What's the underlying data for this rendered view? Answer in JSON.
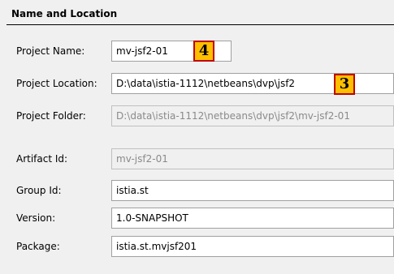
{
  "section": {
    "title": "Name and Location"
  },
  "project_name": {
    "label": "Project Name:",
    "value": "mv-jsf2-01",
    "badge": "4"
  },
  "project_location": {
    "label": "Project Location:",
    "value": "D:\\data\\istia-1112\\netbeans\\dvp\\jsf2",
    "badge": "3"
  },
  "project_folder": {
    "label": "Project Folder:",
    "value": "D:\\data\\istia-1112\\netbeans\\dvp\\jsf2\\mv-jsf2-01"
  },
  "artifact_id": {
    "label": "Artifact Id:",
    "value": "mv-jsf2-01"
  },
  "group_id": {
    "label": "Group Id:",
    "value": "istia.st"
  },
  "version": {
    "label": "Version:",
    "value": "1.0-SNAPSHOT"
  },
  "package": {
    "label": "Package:",
    "value": "istia.st.mvjsf201"
  }
}
